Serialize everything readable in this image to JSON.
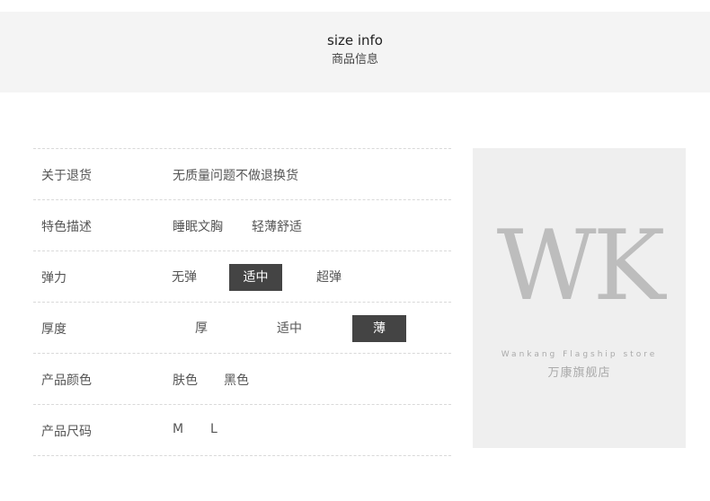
{
  "header": {
    "title_en": "size info",
    "title_cn": "商品信息"
  },
  "rows": [
    {
      "label": "关于退货",
      "values": [
        "无质量问题不做退换货"
      ]
    },
    {
      "label": "特色描述",
      "values": [
        "睡眠文胸",
        "轻薄舒适"
      ]
    },
    {
      "label": "弹力",
      "options": [
        "无弹",
        "适中",
        "超弹"
      ],
      "selected": "适中"
    },
    {
      "label": "厚度",
      "options": [
        "厚",
        "适中",
        "薄"
      ],
      "selected": "薄"
    },
    {
      "label": "产品颜色",
      "values": [
        "肤色",
        "黑色"
      ]
    },
    {
      "label": "产品尺码",
      "values": [
        "M",
        "L"
      ]
    }
  ],
  "brand": {
    "logo": "WK",
    "store_en": "Wankang Flagship store",
    "store_cn": "万康旗舰店"
  },
  "colors": {
    "header_bg": "#f4f4f4",
    "selected_bg": "#444444",
    "brand_bg": "#efefef"
  }
}
